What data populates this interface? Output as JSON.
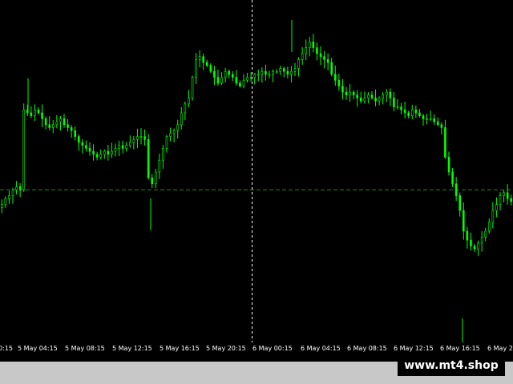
{
  "app": {
    "watermark": "www.mt4.shop"
  },
  "colors": {
    "background": "#000000",
    "bull_candle": "#00ff00",
    "bear_candle": "#00ff00",
    "axis_text": "#ffffff",
    "price_level_line": "#1f8a1f",
    "crosshair": "#ffffff",
    "status_bar": "#c8c8c8"
  },
  "time_axis": {
    "labels": [
      "0:15",
      "5 May 04:15",
      "5 May 08:15",
      "5 May 12:15",
      "5 May 16:15",
      "5 May 20:15",
      "6 May 00:15",
      "6 May 04:15",
      "6 May 08:15",
      "6 May 12:15",
      "6 May 16:15",
      "6 May 2"
    ]
  },
  "chart_data": {
    "type": "candlestick",
    "timeframe_minutes": 15,
    "x_start": "4 May 23:45",
    "price_levels_relative": {
      "min": 0,
      "max": 100,
      "horizontal_line": 44
    },
    "closes": [
      39,
      41,
      42,
      44,
      45,
      44,
      71,
      70,
      69,
      71,
      70,
      68,
      66,
      65,
      66,
      67,
      68,
      66,
      65,
      64,
      62,
      60,
      59,
      58,
      57,
      56,
      55,
      56,
      57,
      56,
      57,
      58,
      59,
      58,
      59,
      60,
      61,
      62,
      62,
      61,
      48,
      46,
      50,
      54,
      58,
      62,
      63,
      64,
      66,
      70,
      73,
      75,
      82,
      88,
      89,
      87,
      86,
      84,
      82,
      80,
      82,
      84,
      83,
      82,
      80,
      79,
      81,
      82,
      82,
      83,
      83,
      84,
      83,
      83,
      84,
      84,
      85,
      84,
      83,
      84,
      85,
      88,
      90,
      92,
      94,
      92,
      90,
      89,
      88,
      87,
      83,
      81,
      79,
      77,
      76,
      77,
      76,
      75,
      74,
      75,
      76,
      75,
      74,
      75,
      76,
      77,
      75,
      72,
      72,
      71,
      70,
      69,
      71,
      70,
      69,
      68,
      68,
      68,
      67,
      66,
      65,
      55,
      50,
      46,
      42,
      37,
      30,
      27,
      25,
      24,
      26,
      28,
      30,
      33,
      37,
      39,
      42,
      43,
      41,
      40
    ]
  }
}
